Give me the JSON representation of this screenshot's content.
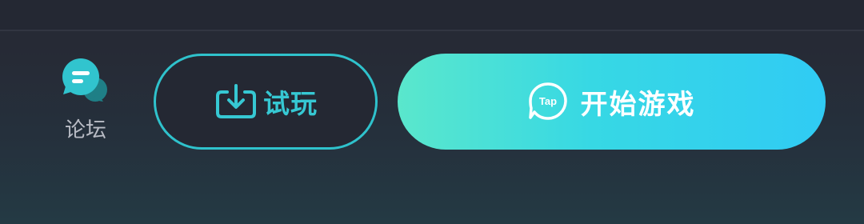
{
  "forum": {
    "label": "论坛",
    "icon": "chat-bubbles-icon"
  },
  "trial_button": {
    "label": "试玩",
    "icon": "download-icon"
  },
  "start_button": {
    "label": "开始游戏",
    "icon_text": "Tap",
    "icon": "taptap-logo-icon"
  },
  "colors": {
    "accent": "#2fc2cc",
    "gradient_start": "#5ae7cc",
    "gradient_end": "#30cbf4",
    "background": "#262a35"
  }
}
